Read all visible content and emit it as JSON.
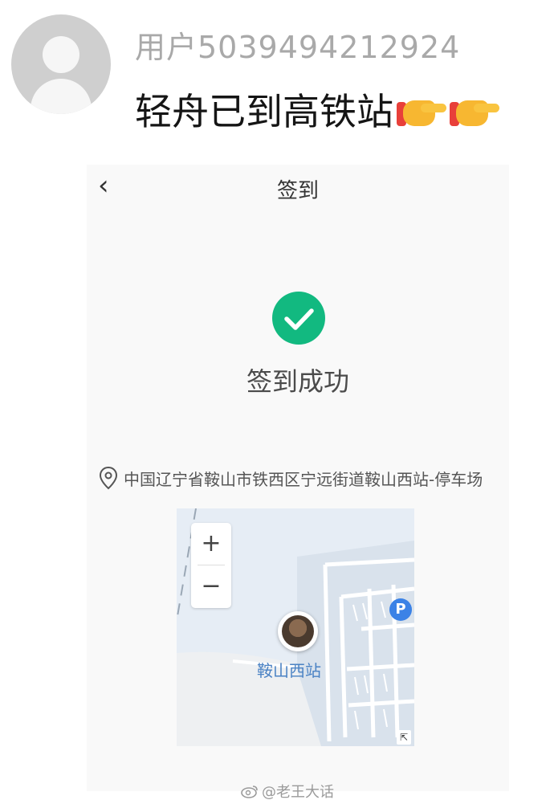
{
  "post": {
    "username": "用户5039494212924",
    "message": "轻舟已到高铁站"
  },
  "checkin": {
    "title": "签到",
    "success_text": "签到成功",
    "location": "中国辽宁省鞍山市铁西区宁远街道鞍山西站-停车场"
  },
  "map": {
    "zoom_in": "+",
    "zoom_out": "−",
    "parking_label": "P",
    "station_label": "鞍山西站",
    "expand_label": "⇱"
  },
  "watermark": "@老王大话",
  "colors": {
    "success": "#12b980",
    "parking": "#3b82e6",
    "station_text": "#4a82c4"
  }
}
